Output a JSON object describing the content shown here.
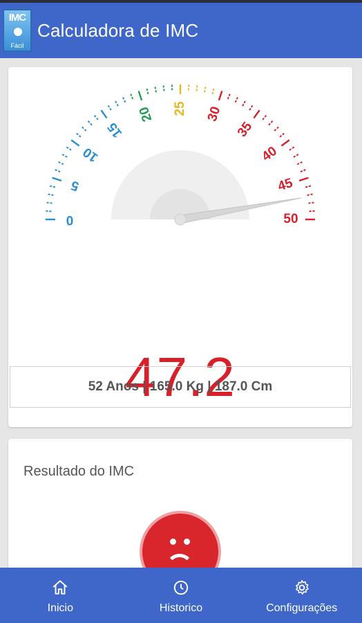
{
  "app_bar": {
    "title": "Calculadora de IMC",
    "logo": {
      "text": "IMC",
      "subtext": "Fácil"
    }
  },
  "gauge": {
    "min": 0,
    "max": 50,
    "needle_value": 47.2,
    "tick_labels": [
      "0",
      "5",
      "10",
      "15",
      "20",
      "25",
      "30",
      "35",
      "40",
      "45",
      "50"
    ],
    "zones": [
      {
        "from": 0,
        "to": 18.5,
        "color": "#2a8fd0"
      },
      {
        "from": 18.5,
        "to": 25,
        "color": "#1e9e55"
      },
      {
        "from": 25,
        "to": 30,
        "color": "#e6b722"
      },
      {
        "from": 30,
        "to": 50,
        "color": "#d8202a"
      }
    ]
  },
  "result": {
    "bmi": "47.2",
    "stats": "52 Anos | 165.0 Kg | 187.0 Cm",
    "section_title": "Resultado do IMC",
    "face_icon": "sad-face-icon"
  },
  "nav": {
    "items": [
      {
        "label": "Inicio",
        "icon": "home-icon"
      },
      {
        "label": "Historico",
        "icon": "history-icon"
      },
      {
        "label": "Configurações",
        "icon": "gear-icon"
      }
    ]
  },
  "colors": {
    "primary": "#3f66c9",
    "danger": "#d8202a"
  }
}
